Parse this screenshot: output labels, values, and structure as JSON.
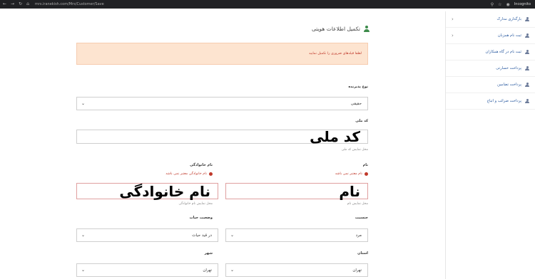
{
  "browser": {
    "url": "mrs.iranekish.com/Mrs/Customer/Save",
    "incognito_label": "Incognito"
  },
  "sidebar": {
    "items": [
      {
        "label": "بارگذاری مدارک",
        "chevron": true
      },
      {
        "label": "ثبت نام همزبان",
        "chevron": true
      },
      {
        "label": "ثبت نام در گاه همکاران",
        "chevron": false
      },
      {
        "label": "پرداخت خسارتی",
        "chevron": false
      },
      {
        "label": "پرداخت تضامین",
        "chevron": false
      },
      {
        "label": "پرداخت ضرائب و اتباع",
        "chevron": false
      }
    ]
  },
  "page": {
    "title": "تکمیل اطلاعات هویتی",
    "alert": "لطفا فیلدهای ضروری را تکمیل نمایید"
  },
  "form": {
    "person_type": {
      "label": "نوع پذیرنده",
      "value": "حقیقی"
    },
    "national_code": {
      "label": "کد ملی",
      "value": "کد ملی",
      "hint": "محل نمایش کد ملی"
    },
    "first_name": {
      "label": "نام",
      "error": "نام معتبر نمی باشد",
      "value": "نام",
      "hint": "محل نمایش نام"
    },
    "last_name": {
      "label": "نام خانوادگی",
      "error": "نام خانوادگی معتبر نمی باشد",
      "value": "نام خانوادگی",
      "hint": "محل نمایش نام خانوادگی"
    },
    "gender": {
      "label": "جنسیت",
      "value": "مرد"
    },
    "life_status": {
      "label": "وضعیت حیات",
      "value": "در قید حیات"
    },
    "province": {
      "label": "استان",
      "value": "تهران"
    },
    "city": {
      "label": "شهر",
      "value": "تهران"
    }
  },
  "colors": {
    "accent_green": "#3d8b4b",
    "error_red": "#c0392b",
    "alert_bg": "#fde4d0",
    "link_blue": "#2a5aa0"
  }
}
